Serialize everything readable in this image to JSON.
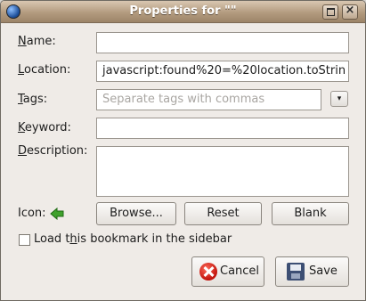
{
  "window": {
    "title": "Properties for \"\""
  },
  "labels": {
    "name_prefix": "",
    "name_ul": "N",
    "name_rest": "ame:",
    "location_prefix": "",
    "location_ul": "L",
    "location_rest": "ocation:",
    "tags_prefix": "",
    "tags_ul": "T",
    "tags_rest": "ags:",
    "keyword_prefix": "",
    "keyword_ul": "K",
    "keyword_rest": "eyword:",
    "description_prefix": "",
    "description_ul": "D",
    "description_rest": "escription:",
    "icon": "Icon:",
    "sidebar_prefix": "Load t",
    "sidebar_ul": "h",
    "sidebar_rest": "is bookmark in the sidebar"
  },
  "fields": {
    "name_value": "",
    "location_value": "javascript:found%20=%20location.toStrin",
    "tags_placeholder": "Separate tags with commas",
    "keyword_value": "",
    "description_value": ""
  },
  "buttons": {
    "browse": "Browse...",
    "reset": "Reset",
    "blank": "Blank",
    "cancel": "Cancel",
    "save": "Save",
    "dropdown_glyph": "▾"
  },
  "checkbox": {
    "load_in_sidebar": false
  },
  "colors": {
    "titlebar": "#b39b7f",
    "window_bg": "#efebe7",
    "icon_arrow": "#3fa12c"
  }
}
